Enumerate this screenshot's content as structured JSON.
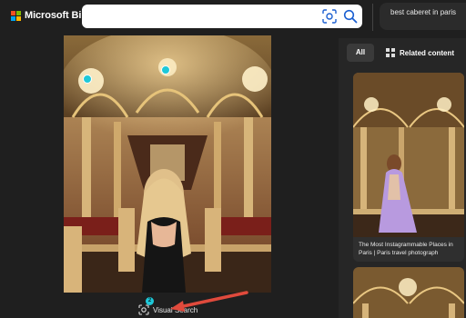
{
  "header": {
    "brand": "Microsoft Bing",
    "search_value": "",
    "query_chip": "best caberet in paris"
  },
  "main_image": {
    "alt": "",
    "hotspot_count": "2"
  },
  "visual_search": {
    "label": "Visual Search",
    "badge": "2"
  },
  "side_panel": {
    "tabs": [
      {
        "label": "All",
        "selected": true
      },
      {
        "label": "Related content",
        "selected": false
      }
    ],
    "results": [
      {
        "title": "The Most Instagrammable Places in Paris | Paris travel photograph"
      }
    ]
  },
  "colors": {
    "background": "#1f1f1f",
    "accent_hotspot": "#1ec8d8",
    "arrow": "#e04a3c",
    "ms_red": "#f25022",
    "ms_green": "#7fba00",
    "ms_blue": "#00a4ef",
    "ms_yellow": "#ffb900"
  },
  "icons": {
    "visual_search": "camera-scan-icon",
    "search": "magnifier-icon",
    "related_content": "grid-icon"
  }
}
